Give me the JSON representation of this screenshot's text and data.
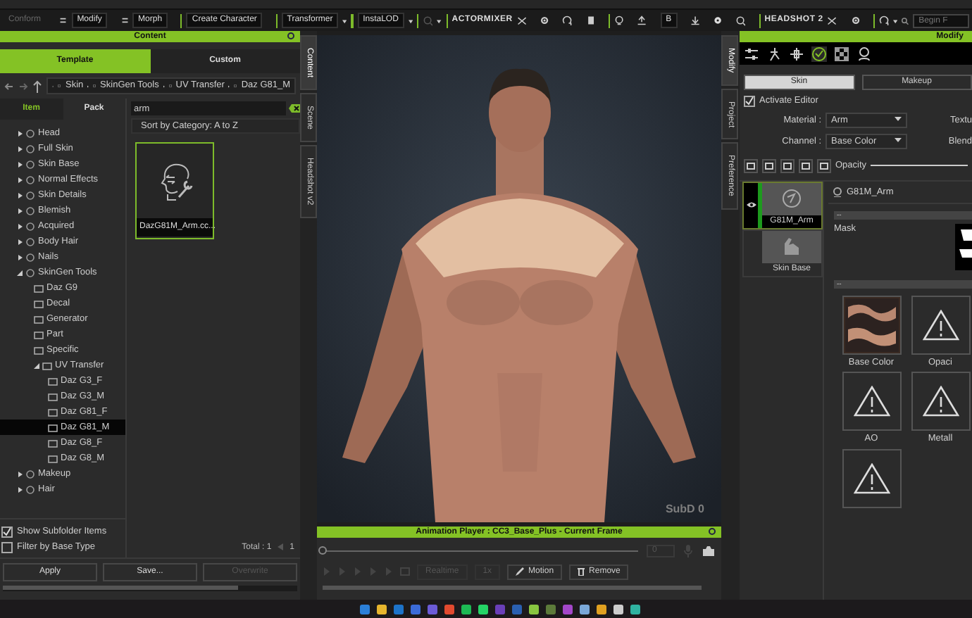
{
  "toolbar": {
    "items": [
      {
        "kind": "button",
        "label": "Conform",
        "disabled": true,
        "dropdown": false
      },
      {
        "kind": "button",
        "label": "Modify",
        "disabled": false,
        "dropdown": false
      },
      {
        "kind": "button",
        "label": "Morph",
        "disabled": false,
        "dropdown": false
      },
      {
        "kind": "separator"
      },
      {
        "kind": "button",
        "label": "Create Character",
        "disabled": false,
        "dropdown": false
      },
      {
        "kind": "separator"
      },
      {
        "kind": "button",
        "label": "Transformer",
        "disabled": false,
        "dropdown": true
      },
      {
        "kind": "separator"
      },
      {
        "kind": "button",
        "label": "InstaLOD",
        "disabled": false,
        "dropdown": true
      },
      {
        "kind": "separator"
      },
      {
        "kind": "icon",
        "disabled": true,
        "dropdown": true
      },
      {
        "kind": "separator"
      },
      {
        "kind": "logo",
        "label": "ACTORMIXER"
      },
      {
        "kind": "icon",
        "disabled": false,
        "dropdown": false
      },
      {
        "kind": "icon",
        "disabled": false,
        "dropdown": false
      },
      {
        "kind": "icon",
        "disabled": false,
        "dropdown": false
      },
      {
        "kind": "icon",
        "disabled": false,
        "dropdown": false
      },
      {
        "kind": "separator"
      },
      {
        "kind": "icon",
        "disabled": false,
        "dropdown": false
      },
      {
        "kind": "icon",
        "disabled": false,
        "dropdown": false
      },
      {
        "kind": "button",
        "label": "B",
        "disabled": false,
        "dropdown": false
      },
      {
        "kind": "icon",
        "disabled": false,
        "dropdown": false
      },
      {
        "kind": "icon",
        "disabled": false,
        "dropdown": false
      },
      {
        "kind": "icon",
        "disabled": false,
        "dropdown": false
      },
      {
        "kind": "separator"
      },
      {
        "kind": "logo",
        "label": "HEADSHOT 2"
      },
      {
        "kind": "icon",
        "disabled": false,
        "dropdown": false
      },
      {
        "kind": "icon",
        "disabled": false,
        "dropdown": false
      },
      {
        "kind": "separator"
      },
      {
        "kind": "icon",
        "disabled": false,
        "dropdown": true
      },
      {
        "kind": "search",
        "placeholder": "Begin F"
      }
    ]
  },
  "content_panel": {
    "title": "Content",
    "tabs": [
      {
        "label": "Template",
        "selected": true
      },
      {
        "label": "Custom",
        "selected": false
      }
    ],
    "breadcrumb": [
      "Skin",
      "SkinGen Tools",
      "UV Transfer",
      "Daz G81_M"
    ],
    "side_tabs": [
      {
        "label": "Item",
        "selected": true
      },
      {
        "label": "Pack",
        "selected": false
      }
    ],
    "tree": [
      {
        "label": "Head",
        "expanded": false,
        "selected": false
      },
      {
        "label": "Full Skin",
        "expanded": false,
        "selected": false
      },
      {
        "label": "Skin Base",
        "expanded": false,
        "selected": false
      },
      {
        "label": "Normal Effects",
        "expanded": false,
        "selected": false
      },
      {
        "label": "Skin Details",
        "expanded": false,
        "selected": false
      },
      {
        "label": "Blemish",
        "expanded": false,
        "selected": false
      },
      {
        "label": "Acquired",
        "expanded": false,
        "selected": false
      },
      {
        "label": "Body Hair",
        "expanded": false,
        "selected": false
      },
      {
        "label": "Nails",
        "expanded": false,
        "selected": false
      },
      {
        "label": "SkinGen Tools",
        "expanded": true,
        "selected": false,
        "children": [
          {
            "label": "Daz G9",
            "selected": false
          },
          {
            "label": "Decal",
            "selected": false
          },
          {
            "label": "Generator",
            "selected": false
          },
          {
            "label": "Part",
            "selected": false
          },
          {
            "label": "Specific",
            "selected": false
          },
          {
            "label": "UV Transfer",
            "expanded": true,
            "selected": false,
            "children": [
              {
                "label": "Daz G3_F",
                "selected": false
              },
              {
                "label": "Daz G3_M",
                "selected": false
              },
              {
                "label": "Daz G81_F",
                "selected": false
              },
              {
                "label": "Daz G81_M",
                "selected": true
              },
              {
                "label": "Daz G8_F",
                "selected": false
              },
              {
                "label": "Daz G8_M",
                "selected": false
              }
            ]
          }
        ]
      },
      {
        "label": "Makeup",
        "expanded": false,
        "selected": false
      },
      {
        "label": "Hair",
        "expanded": false,
        "selected": false
      }
    ],
    "options": [
      {
        "label": "Show Subfolder Items",
        "checked": true
      },
      {
        "label": "Filter by Base Type",
        "checked": false
      }
    ],
    "search": {
      "value": "arm"
    },
    "sort": "Sort by Category: A to Z",
    "items": [
      {
        "label": "DazG81M_Arm.cc...",
        "selected": true
      }
    ],
    "total": "Total : 1",
    "page": "1",
    "buttons": [
      {
        "label": "Apply",
        "disabled": false
      },
      {
        "label": "Save...",
        "disabled": false
      },
      {
        "label": "Overwrite",
        "disabled": true
      }
    ]
  },
  "left_dock_tabs": [
    {
      "label": "Content",
      "selected": true
    },
    {
      "label": "Scene",
      "selected": false
    },
    {
      "label": "Headshot v2",
      "selected": false
    }
  ],
  "viewport": {
    "badge": "SubD 0"
  },
  "animation_player": {
    "title": "Animation Player : CC3_Base_Plus - Current Frame",
    "frame": "0",
    "level": 0,
    "speed": "1x",
    "buttons": [
      {
        "label": "Realtime",
        "kind": "plain",
        "disabled": true
      },
      {
        "label": "Motion",
        "kind": "motion",
        "disabled": false
      },
      {
        "label": "Remove",
        "kind": "remove",
        "disabled": false
      }
    ]
  },
  "right_dock_tabs": [
    {
      "label": "Modify",
      "selected": true
    },
    {
      "label": "Project",
      "selected": false
    },
    {
      "label": "Preference",
      "selected": false
    }
  ],
  "modify_panel": {
    "title": "Modify",
    "icon_tabs": [
      {
        "selected": false
      },
      {
        "selected": false
      },
      {
        "selected": false
      },
      {
        "selected": true
      },
      {
        "selected": false
      },
      {
        "selected": false
      }
    ],
    "mode_tabs": [
      {
        "label": "Skin",
        "selected": true
      },
      {
        "label": "Makeup",
        "selected": false
      }
    ],
    "activate_editor": {
      "label": "Activate Editor",
      "checked": true
    },
    "fields": [
      {
        "label": "Material :",
        "value": "Arm",
        "side_label": "Textu"
      },
      {
        "label": "Channel :",
        "value": "Base Color",
        "side_label": "Blend"
      }
    ],
    "opacity": {
      "label": "Opacity",
      "level": 1
    },
    "layers": [
      {
        "label": "G81M_Arm",
        "selected": true,
        "visible": true
      },
      {
        "label": "Skin Base",
        "selected": false,
        "visible": false
      }
    ],
    "layer_title": "G81M_Arm",
    "section_bars": [
      "--",
      "--"
    ],
    "mask_label": "Mask",
    "slots": [
      {
        "kind": "texture",
        "label": "Base Color"
      },
      {
        "kind": "empty",
        "label": "Opaci"
      },
      {
        "kind": "empty",
        "label": "AO"
      },
      {
        "kind": "empty",
        "label": "Metall"
      },
      {
        "kind": "empty"
      }
    ]
  }
}
